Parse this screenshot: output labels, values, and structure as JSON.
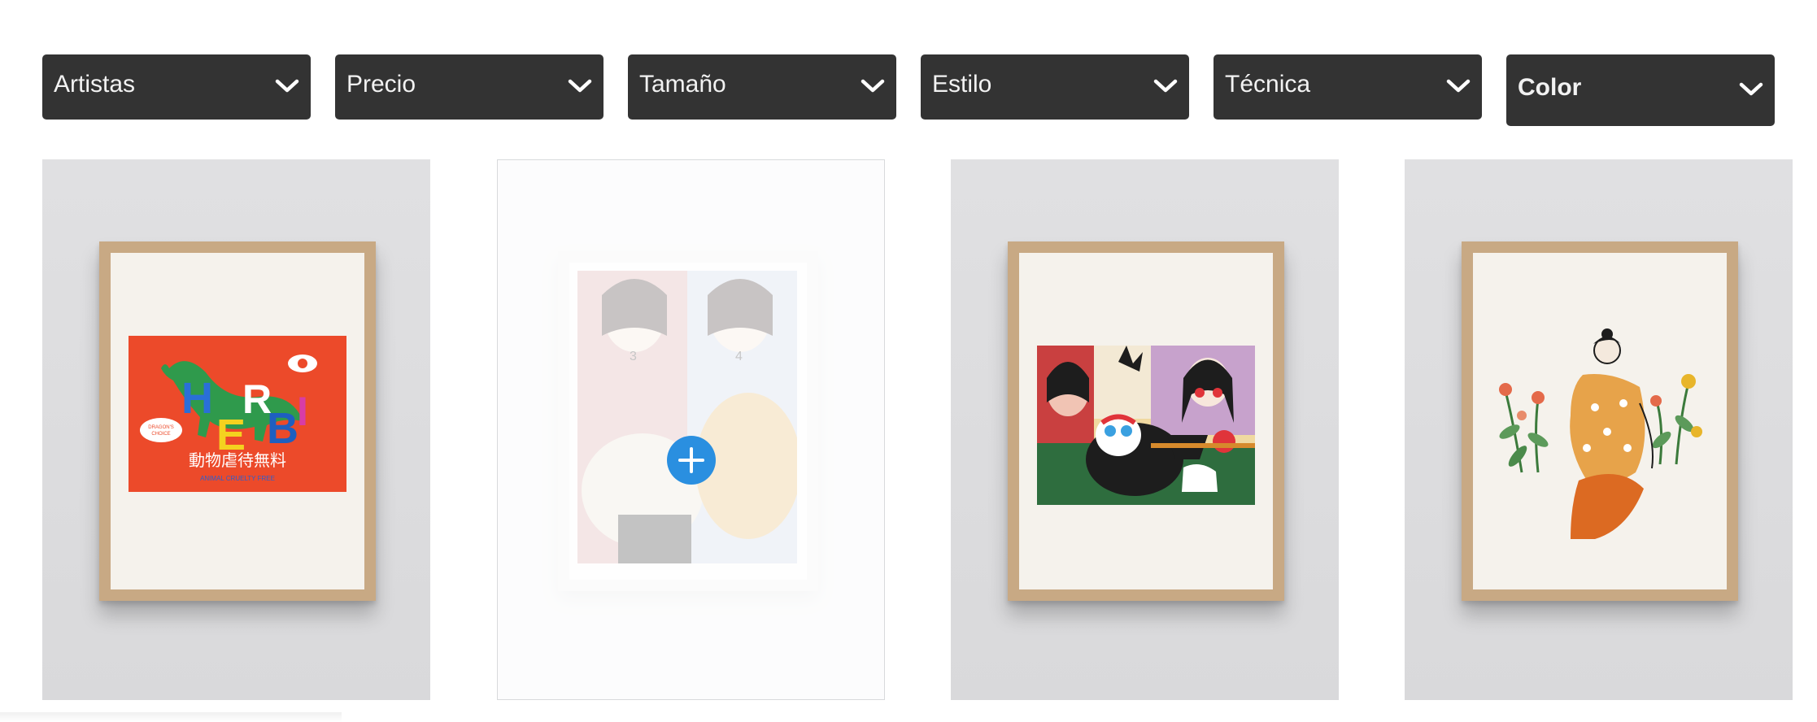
{
  "filters": [
    {
      "label": "Artistas"
    },
    {
      "label": "Precio"
    },
    {
      "label": "Tamaño"
    },
    {
      "label": "Estilo"
    },
    {
      "label": "Técnica"
    },
    {
      "label": "Color"
    }
  ],
  "products": [
    {
      "art": {
        "word": "HERBI",
        "subtitle": "動物虐待無料",
        "small": "ANIMAL CRUELTY FREE",
        "badge": "DRAGON'S CHOICE",
        "background": "#ec4a2a"
      }
    },
    {
      "art": {
        "numbers": [
          "3",
          "4"
        ]
      },
      "hover": true
    },
    {
      "art": {}
    },
    {
      "art": {}
    }
  ],
  "colors": {
    "filter_bg": "#333333",
    "add_button": "#2a8fe0"
  }
}
